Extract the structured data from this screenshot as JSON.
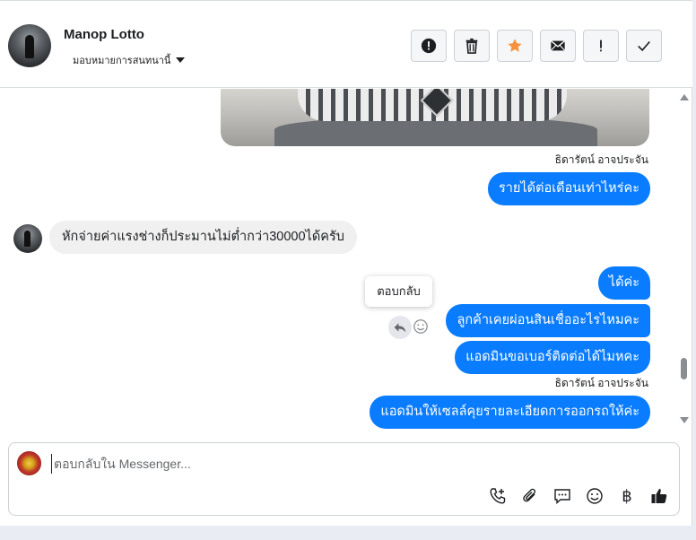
{
  "header": {
    "contact_name": "Manop Lotto",
    "assign_label": "มอบหมายการสนทนานี้"
  },
  "toolbar": {
    "buttons": [
      {
        "name": "spam-button",
        "icon": "alert-circle-icon"
      },
      {
        "name": "delete-button",
        "icon": "trash-icon"
      },
      {
        "name": "star-button",
        "icon": "star-icon",
        "color": "#f7923b"
      },
      {
        "name": "mail-button",
        "icon": "envelope-icon"
      },
      {
        "name": "flag-button",
        "icon": "exclamation-icon"
      },
      {
        "name": "done-button",
        "icon": "check-icon"
      }
    ]
  },
  "messages": {
    "sender_1": "ธิดารัตน์ อาจประจัน",
    "out_1": "รายได้ต่อเดือนเท่าไหร่คะ",
    "in_1": "หักจ่ายค่าแรงช่างก็ประมานไม่ต่ำกว่า30000ได้ครับ",
    "out_2": "ได้ค่ะ",
    "out_3": "ลูกค้าเคยผ่อนสินเชื่ออะไรไหมคะ",
    "out_4": "แอดมินขอเบอร์ติดต่อได้ไมหคะ",
    "sender_2": "ธิดารัตน์ อาจประจัน",
    "out_5": "แอดมินให้เซลล์คุยรายละเอียดการออกรถให้ค่ะ",
    "tooltip": "ตอบกลับ"
  },
  "composer": {
    "placeholder": "ตอบกลับใน Messenger...",
    "baht_symbol": "฿"
  },
  "colors": {
    "outgoing_bubble": "#0a7cff",
    "incoming_bubble": "#f0f0f0",
    "star": "#f7923b"
  }
}
